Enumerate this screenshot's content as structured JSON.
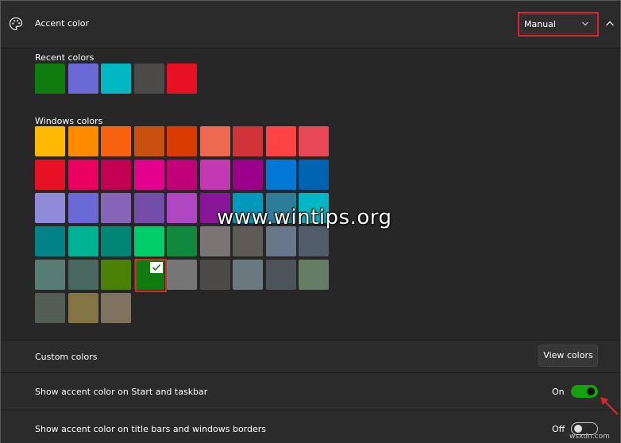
{
  "header": {
    "title": "Accent color",
    "dropdown_value": "Manual"
  },
  "recent": {
    "label": "Recent colors",
    "colors": [
      "#107c10",
      "#6b69d6",
      "#00b7c3",
      "#4c4a48",
      "#e81123"
    ]
  },
  "windows": {
    "label": "Windows colors",
    "selected_color": "#107c10",
    "rows": [
      [
        "#ffb900",
        "#ff8c00",
        "#f7630c",
        "#ca5010",
        "#da3b01",
        "#ef6950",
        "#d13438",
        "#ff4343",
        "#e74856"
      ],
      [
        "#e81123",
        "#ea005e",
        "#c30052",
        "#e3008c",
        "#bf0077",
        "#c239b3",
        "#9a0089",
        "#0078d7",
        "#0063b1"
      ],
      [
        "#8e8cd8",
        "#6b69d6",
        "#8764b8",
        "#744da9",
        "#b146c2",
        "#881798",
        "#0099bc",
        "#2d7d9a",
        "#00b7c3"
      ],
      [
        "#038387",
        "#00b294",
        "#018574",
        "#00cc6a",
        "#10893e",
        "#7a7574",
        "#5d5a58",
        "#68768a",
        "#515c6b"
      ],
      [
        "#567c73",
        "#486860",
        "#498205",
        "#107c10",
        "#767676",
        "#4c4a48",
        "#69797e",
        "#4a5459",
        "#647c64"
      ],
      [
        "#525e54",
        "#847545",
        "#7e735f"
      ]
    ]
  },
  "watermark": "www.wintips.org",
  "custom": {
    "label": "Custom colors",
    "button": "View colors"
  },
  "taskbar": {
    "label": "Show accent color on Start and taskbar",
    "state": "On"
  },
  "titlebars": {
    "label": "Show accent color on title bars and windows borders",
    "state": "Off"
  },
  "corner_mark": "wsxdn.com"
}
